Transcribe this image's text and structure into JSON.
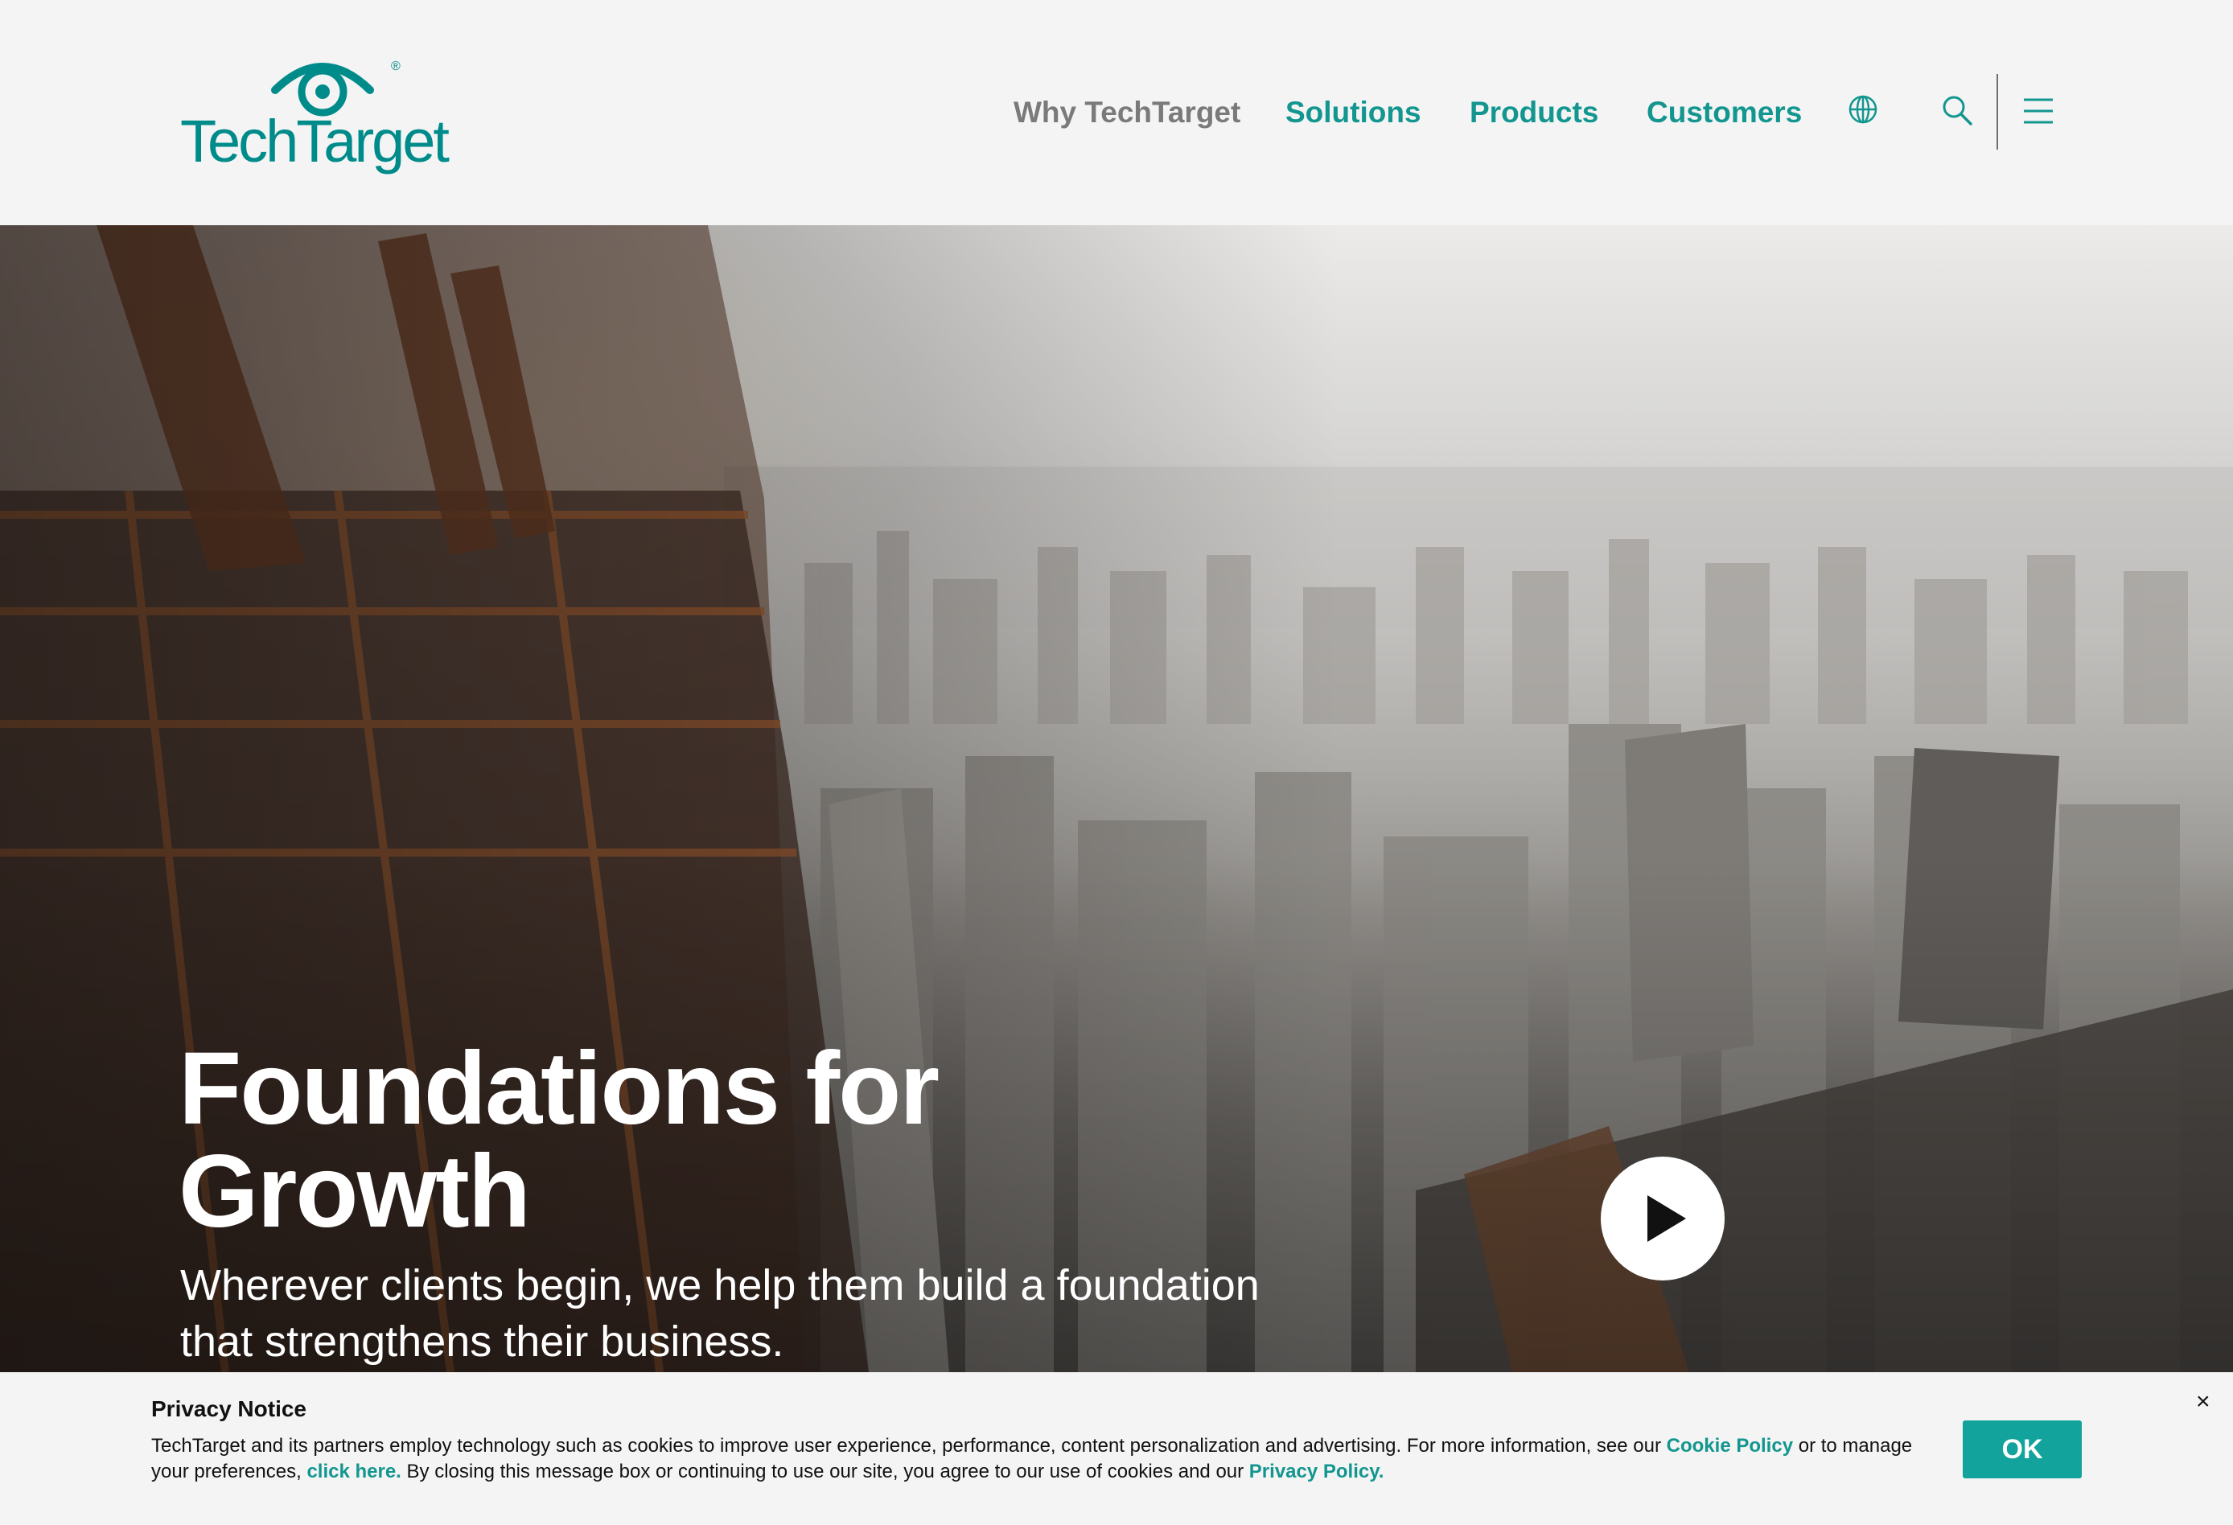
{
  "brand": {
    "name": "TechTarget",
    "registered_mark": "®",
    "accent_color": "#12968f"
  },
  "nav": {
    "items": [
      {
        "label": "Why TechTarget"
      },
      {
        "label": "Solutions"
      },
      {
        "label": "Products"
      },
      {
        "label": "Customers"
      }
    ],
    "icons": [
      "globe-icon",
      "search-icon",
      "hamburger-menu-icon"
    ]
  },
  "hero": {
    "title_line1": "Foundations for",
    "title_line2": "Growth",
    "subtitle_line1": "Wherever clients begin, we help them build a foundation",
    "subtitle_line2": "that strengthens their business.",
    "play_icon": "play-icon"
  },
  "privacy": {
    "title": "Privacy Notice",
    "text_part1": "TechTarget and its partners employ technology such as cookies to improve user experience, performance, content personalization and advertising. For more information, see our ",
    "cookie_link": "Cookie Policy",
    "text_part2": " or to manage your preferences, ",
    "click_link": "click here.",
    "text_part3": " By closing this message box or continuing to use our site, you agree to our use of cookies and our ",
    "privacy_link": "Privacy Policy.",
    "ok_label": "OK",
    "close_label": "×"
  }
}
